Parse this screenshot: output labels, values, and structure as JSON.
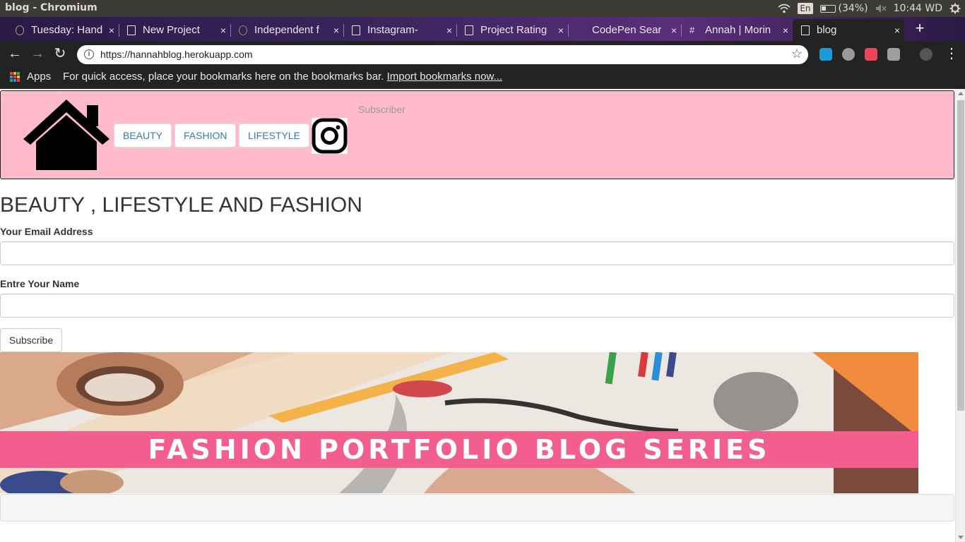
{
  "window": {
    "title": "blog - Chromium"
  },
  "os": {
    "language": "En",
    "battery": "(34%)",
    "clock": "10:44 WD"
  },
  "tabs": [
    {
      "label": "Tuesday: Hand",
      "close": "×"
    },
    {
      "label": "New Project",
      "close": "×"
    },
    {
      "label": "Independent f",
      "close": "×"
    },
    {
      "label": "Instagram-",
      "close": "×"
    },
    {
      "label": "Project Rating",
      "close": "×"
    },
    {
      "label": "CodePen Sear",
      "close": "×"
    },
    {
      "label": "Annah | Morin",
      "close": "×"
    },
    {
      "label": "blog",
      "close": "×"
    }
  ],
  "toolbar": {
    "url": "https://hannahblog.herokuapp.com"
  },
  "bookmarks": {
    "apps_label": "Apps",
    "hint": "For quick access, place your bookmarks here on the bookmarks bar. ",
    "import_link": "Import bookmarks now..."
  },
  "site": {
    "nav": {
      "beauty": "BEAUTY",
      "fashion": "FASHION",
      "lifestyle": "LIFESTYLE",
      "subscriber": "Subscriber"
    },
    "heading": "BEAUTY , LIFESTYLE AND FASHION",
    "form": {
      "email_label": "Your Email Address",
      "email_value": "",
      "name_label": "Entre Your Name",
      "name_value": "",
      "submit_label": "Subscribe"
    },
    "banner": {
      "text": "FASHION PORTFOLIO BLOG SERIES"
    }
  }
}
